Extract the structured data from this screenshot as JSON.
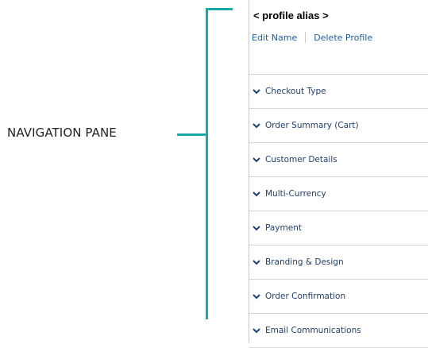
{
  "annotation": {
    "label": "NAVIGATION PANE",
    "accent_color": "#1aa8a8"
  },
  "profile": {
    "alias": "< profile alias >",
    "edit_label": "Edit Name",
    "delete_label": "Delete Profile"
  },
  "sections": [
    {
      "label": "Checkout Type",
      "icon": "chevron-down-icon"
    },
    {
      "label": "Order Summary (Cart)",
      "icon": "chevron-down-icon"
    },
    {
      "label": "Customer Details",
      "icon": "chevron-down-icon"
    },
    {
      "label": "Multi-Currency",
      "icon": "chevron-down-icon"
    },
    {
      "label": "Payment",
      "icon": "chevron-down-icon"
    },
    {
      "label": "Branding & Design",
      "icon": "chevron-down-icon"
    },
    {
      "label": "Order Confirmation",
      "icon": "chevron-down-icon"
    },
    {
      "label": "Email Communications",
      "icon": "chevron-down-icon"
    }
  ],
  "colors": {
    "link": "#1f5fa8",
    "section_text": "#1f3f73",
    "divider": "#d4d4d4"
  }
}
